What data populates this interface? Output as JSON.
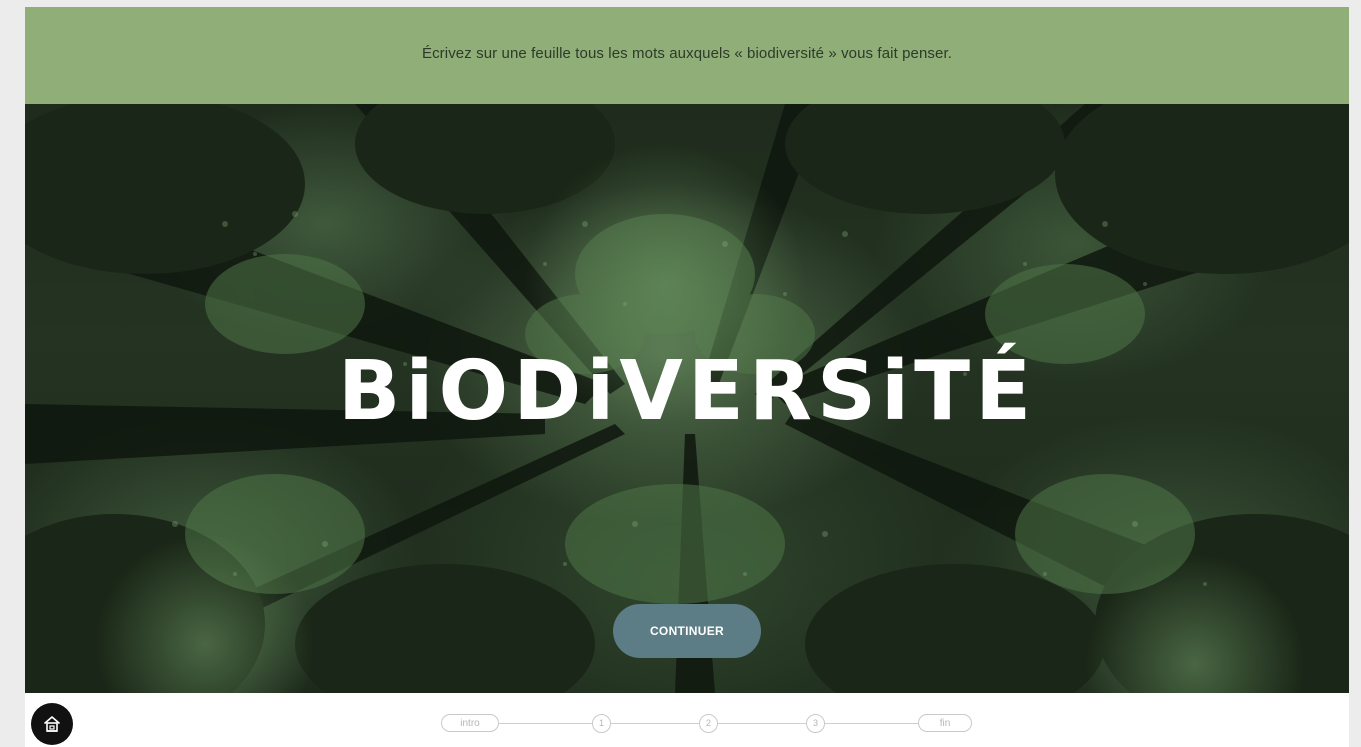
{
  "banner": {
    "instruction": "Écrivez sur une feuille tous les mots auxquels « biodiversité » vous fait penser."
  },
  "hero": {
    "title": "BiODiVERSiTÉ",
    "continue_label": "CONTINUER"
  },
  "footer": {
    "home_icon": "home-icon",
    "steps": [
      {
        "label": "intro",
        "kind": "pill"
      },
      {
        "label": "1",
        "kind": "circle"
      },
      {
        "label": "2",
        "kind": "circle"
      },
      {
        "label": "3",
        "kind": "circle"
      },
      {
        "label": "fin",
        "kind": "pill"
      }
    ]
  },
  "colors": {
    "banner_bg": "#8fae78",
    "button_bg": "#5c7c86",
    "hero_tint": "#2a3d27"
  }
}
